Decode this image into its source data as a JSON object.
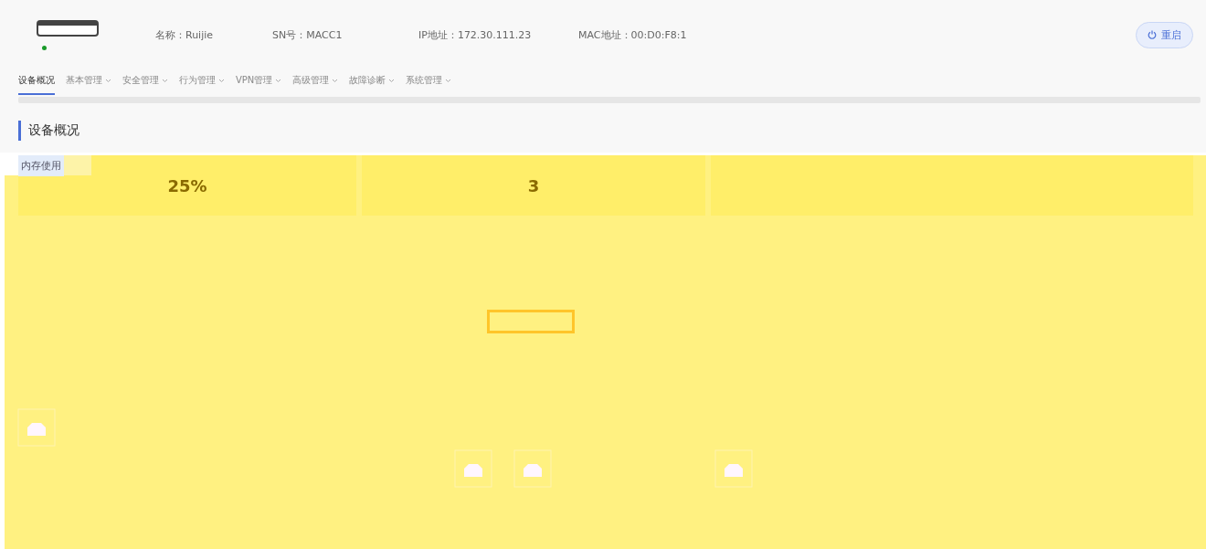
{
  "device": {
    "online": true,
    "info": [
      {
        "label": "名称：",
        "value": "Ruijie"
      },
      {
        "label": "SN号：",
        "value": "MACC1"
      },
      {
        "label": "IP地址：",
        "value": "172.30.111.23"
      },
      {
        "label": "MAC地址：",
        "value": "00:D0:F8:1"
      }
    ],
    "reboot_button": "重启"
  },
  "tabs": [
    {
      "label": "设备概况",
      "selected": true,
      "has_menu": false
    },
    {
      "label": "基本管理",
      "selected": false,
      "has_menu": true
    },
    {
      "label": "安全管理",
      "selected": false,
      "has_menu": true
    },
    {
      "label": "行为管理",
      "selected": false,
      "has_menu": true
    },
    {
      "label": "VPN管理",
      "selected": false,
      "has_menu": true
    },
    {
      "label": "高级管理",
      "selected": false,
      "has_menu": true
    },
    {
      "label": "故障诊断",
      "selected": false,
      "has_menu": true
    },
    {
      "label": "系统管理",
      "selected": false,
      "has_menu": true
    }
  ],
  "section_title": "设备概况",
  "cards": [
    {
      "label": "内存使用",
      "value": "25%"
    },
    {
      "value": "3"
    }
  ]
}
